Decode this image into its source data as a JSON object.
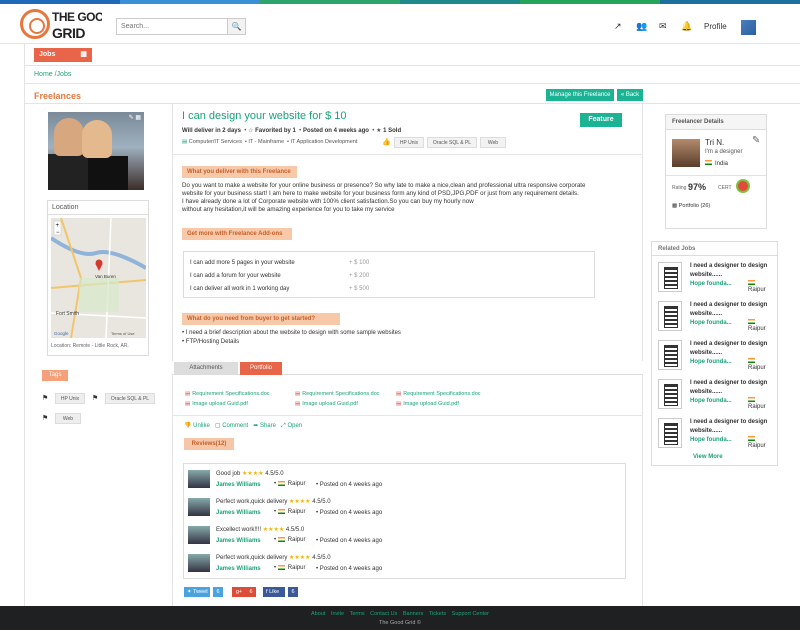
{
  "brand": {
    "logo_text": "THE GOOD GRID"
  },
  "header": {
    "search_placeholder": "Search...",
    "profile_label": "Profile"
  },
  "nav": {
    "jobs_tab": "Jobs",
    "breadcrumb": "Home /Jobs",
    "section_title": "Freelances"
  },
  "top_buttons": {
    "manage": "Manage this Freelance",
    "back": "« Back"
  },
  "location": {
    "title": "Location",
    "caption": "Location: Remote - Little Rock, AR.",
    "map_labels": [
      "Van Buren",
      "Fort Smith",
      "Google",
      "Terms of Use"
    ]
  },
  "tags": {
    "label": "Tags",
    "items": [
      "HP Unix",
      "Oracle SQL & PL",
      "Web"
    ]
  },
  "gig": {
    "title": "I can design your website for $ 10",
    "feature_label": "Feature",
    "delivery": "Will deliver in 2 days",
    "favorited": "Favorited by 1",
    "posted": "Posted on 4 weeks ago",
    "sold": "1 Sold",
    "categories": [
      "Computer/IT Services",
      "IT - Mainframe",
      "IT Application Development"
    ],
    "skills": [
      "HP Unix",
      "Oracle SQL & PL",
      "Web"
    ],
    "deliver_header": "What you deliver with this Freelance",
    "description": [
      "Do you want to make a website for your online business or presence? So why late to make a nice,clean and professional ultra responsive corporate",
      "website for your business start!   I am here to make website for your business form any kind of PSD,JPG,PDF or just from any requirement details.",
      "I have already done a lot of Corporate website with 100% client satisfaction.So you can buy my hourly now",
      "without any hesitation,it will be amazing experience for you to take my service"
    ],
    "addons_header": "Get more with Freelance Add-ons",
    "addons": [
      {
        "label": "I can add more 5 pages in your website",
        "price": "+ $  100"
      },
      {
        "label": "I can add a forum for your website",
        "price": "+ $  200"
      },
      {
        "label": "I can deliver all work in 1 working day",
        "price": "+ $  500"
      }
    ],
    "need_header": "What do you need from buyer to get started?",
    "requirements": [
      "I need a brief description about the website to design with some sample websites",
      "FTP/Hosting Details"
    ]
  },
  "tabs": {
    "attachments": "Attachments",
    "portfolio": "Portfolio"
  },
  "files": [
    {
      "name": "Requirement Specifications.doc"
    },
    {
      "name": "Requirement Specifications.doc"
    },
    {
      "name": "Requirement Specifications.doc"
    },
    {
      "name": "Image upload Guid.pdf"
    },
    {
      "name": "Image upload Guid.pdf"
    },
    {
      "name": "Image upload Guid.pdf"
    }
  ],
  "actions": {
    "unlike": "Unlike",
    "comment": "Comment",
    "share": "Share",
    "open": "Open"
  },
  "reviews": {
    "header": "Reviews(12)",
    "items": [
      {
        "comment": "Good job",
        "stars": "★★★★",
        "rating": "4.5/5.0",
        "name": "James Williams",
        "city": "Raipur",
        "ago": "Posted on 4 weeks ago"
      },
      {
        "comment": "Perfect work,quick delivery",
        "stars": "★★★★",
        "rating": "4.5/5.0",
        "name": "James Williams",
        "city": "Raipur",
        "ago": "Posted on 4 weeks ago"
      },
      {
        "comment": "Excellect work!!!!",
        "stars": "★★★★",
        "rating": "4.5/5.0",
        "name": "James Williams",
        "city": "Raipur",
        "ago": "Posted on 4 weeks ago"
      },
      {
        "comment": "Perfect work,quick delivery",
        "stars": "★★★★",
        "rating": "4.5/5.0",
        "name": "James Williams",
        "city": "Raipur",
        "ago": "Posted on 4 weeks ago"
      }
    ]
  },
  "social": {
    "tweet": "Tweet",
    "tweet_count": "6",
    "gplus": "g+",
    "gplus_count": "6",
    "like": "Like",
    "like_count": "6"
  },
  "freelancer": {
    "header": "Freelancer Details",
    "name": "Tri N.",
    "tagline": "I'm a designer",
    "country": "India",
    "rating_label": "Rating",
    "rating": "97%",
    "cert_label": "CERT",
    "portfolio": "Portfolio (26)"
  },
  "related": {
    "header": "Related  Jobs",
    "items": [
      {
        "title": "I need a designer to design website......",
        "company": "Hope founda...",
        "city": "Raipur"
      },
      {
        "title": "I need a designer to design website......",
        "company": "Hope founda...",
        "city": "Raipur"
      },
      {
        "title": "I need a designer to design website......",
        "company": "Hope founda...",
        "city": "Raipur"
      },
      {
        "title": "I need a designer to design website......",
        "company": "Hope founda...",
        "city": "Raipur"
      },
      {
        "title": "I need a designer to design website......",
        "company": "Hope founda...",
        "city": "Raipur"
      }
    ],
    "view_more": "View More"
  },
  "footer": {
    "links": [
      "About",
      "Invite",
      "Terms",
      "Contact Us",
      "Banners",
      "Tickets",
      "Support Center"
    ],
    "copyright": "The Good Grid ©"
  },
  "colors": {
    "accent_green": "#1ab394",
    "accent_orange": "#e8773f",
    "tab_red": "#e8654a"
  }
}
